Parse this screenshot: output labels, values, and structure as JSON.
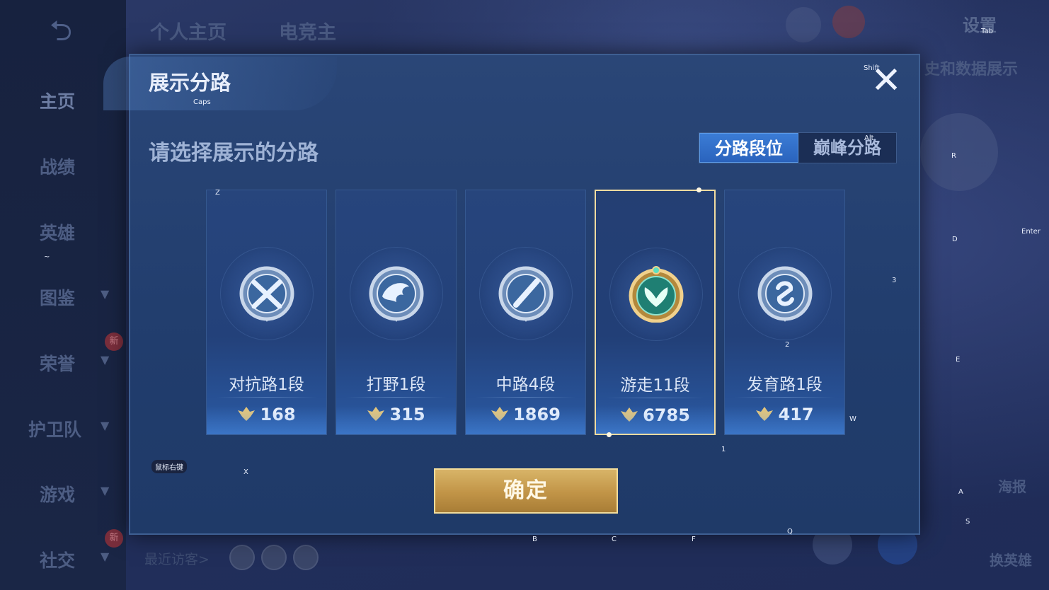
{
  "background": {
    "sidebar": [
      {
        "label": "主页",
        "chevron": false,
        "active": true
      },
      {
        "label": "战绩",
        "chevron": false
      },
      {
        "label": "英雄",
        "chevron": false
      },
      {
        "label": "图鉴",
        "chevron": true
      },
      {
        "label": "荣誉",
        "chevron": true,
        "badge": "新"
      },
      {
        "label": "护卫队",
        "chevron": true
      },
      {
        "label": "游戏",
        "chevron": true
      },
      {
        "label": "社交",
        "chevron": true,
        "badge": "新"
      }
    ],
    "top_tabs": [
      "个人主页",
      "电竞主"
    ],
    "settings_label": "设置",
    "right_text": "史和数据展示",
    "poster_label": "海报",
    "swap_hero_label": "换英雄",
    "recent_visitors": "最近访客>"
  },
  "modal": {
    "title": "展示分路",
    "close_glyph": "✕",
    "subtitle": "请选择展示的分路",
    "segments": [
      "分路段位",
      "巅峰分路"
    ],
    "active_segment": 0,
    "lanes": [
      {
        "name": "对抗路1段",
        "score": "168",
        "emblem": "crossed-swords-emblem-icon",
        "selected": false
      },
      {
        "name": "打野1段",
        "score": "315",
        "emblem": "dragon-emblem-icon",
        "selected": false
      },
      {
        "name": "中路4段",
        "score": "1869",
        "emblem": "staff-emblem-icon",
        "selected": false
      },
      {
        "name": "游走11段",
        "score": "6785",
        "emblem": "wings-gold-emblem-icon",
        "selected": true
      },
      {
        "name": "发育路1段",
        "score": "417",
        "emblem": "bow-emblem-icon",
        "selected": false
      }
    ],
    "confirm_label": "确定"
  },
  "key_hints": {
    "caps": "Caps",
    "shift": "Shift",
    "alt": "Alt",
    "tab": "Tab",
    "z": "Z",
    "x": "X",
    "r": "R",
    "d": "D",
    "enter": "Enter",
    "three": "3",
    "two": "2",
    "e": "E",
    "w": "W",
    "one": "1",
    "mouse_right": "鼠标右键",
    "b": "B",
    "c": "C",
    "f": "F",
    "q": "Q",
    "a": "A",
    "s": "S",
    "tilde": "~"
  },
  "colors": {
    "accent_blue": "#2a63bd",
    "gold": "#c19447",
    "selected_border": "#f1dca0"
  }
}
